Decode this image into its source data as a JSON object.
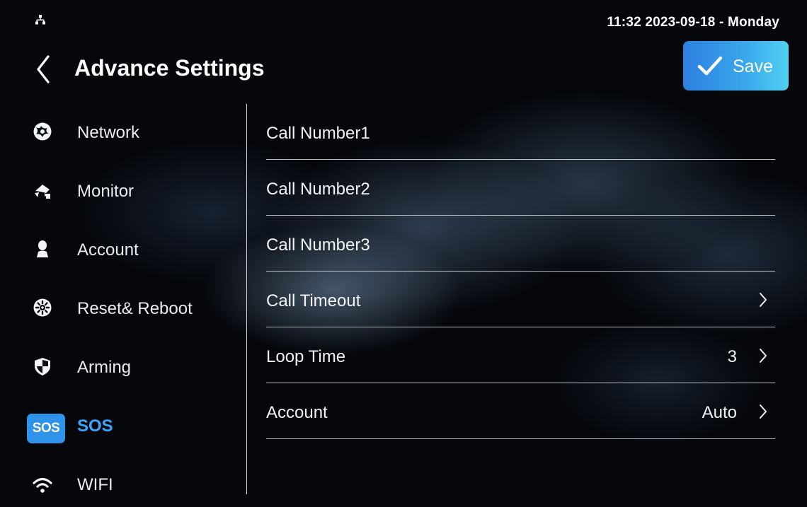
{
  "status_bar": {
    "datetime": "11:32  2023-09-18 - Monday",
    "network_icon": "network-tree-icon"
  },
  "header": {
    "back_icon": "chevron-left-icon",
    "title": "Advance Settings",
    "save_label": "Save",
    "save_icon": "checkmark-icon"
  },
  "sidebar": {
    "items": [
      {
        "label": "Network",
        "icon": "network-globe-icon"
      },
      {
        "label": "Monitor",
        "icon": "camera-icon"
      },
      {
        "label": "Account",
        "icon": "person-icon"
      },
      {
        "label": "Reset& Reboot",
        "icon": "reset-gear-icon"
      },
      {
        "label": "Arming",
        "icon": "shield-icon"
      },
      {
        "label": "SOS",
        "icon": "sos-badge-icon",
        "badge_text": "SOS",
        "active": true
      },
      {
        "label": "WIFI",
        "icon": "wifi-icon"
      }
    ]
  },
  "settings": {
    "rows": [
      {
        "label": "Call Number1",
        "value": "",
        "has_chevron": false
      },
      {
        "label": "Call Number2",
        "value": "",
        "has_chevron": false
      },
      {
        "label": "Call Number3",
        "value": "",
        "has_chevron": false
      },
      {
        "label": "Call Timeout",
        "value": "",
        "has_chevron": true
      },
      {
        "label": "Loop Time",
        "value": "3",
        "has_chevron": true
      },
      {
        "label": "Account",
        "value": "Auto",
        "has_chevron": true
      }
    ]
  },
  "colors": {
    "accent": "#3aa7ff",
    "save_gradient_start": "#2d7fe0",
    "save_gradient_end": "#52d1f3",
    "divider": "#b9bdc2"
  }
}
